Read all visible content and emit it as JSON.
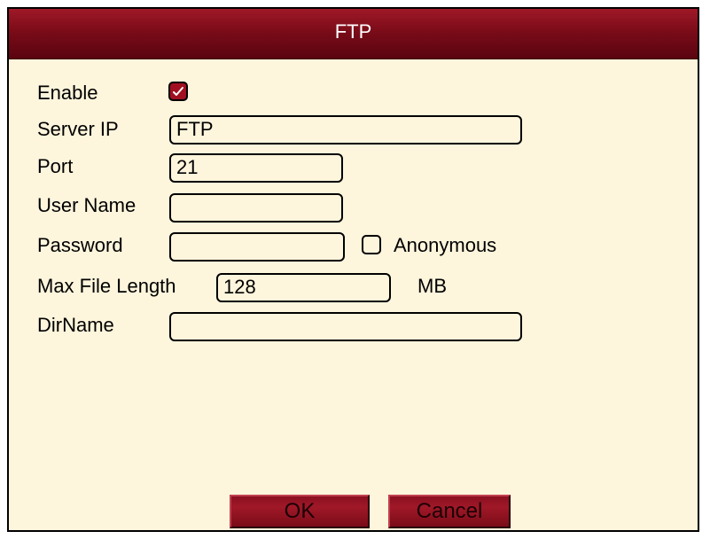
{
  "dialog": {
    "title": "FTP"
  },
  "form": {
    "enable": {
      "label": "Enable",
      "checked": true
    },
    "server_ip": {
      "label": "Server IP",
      "value": "FTP"
    },
    "port": {
      "label": "Port",
      "value": "21"
    },
    "user_name": {
      "label": "User Name",
      "value": ""
    },
    "password": {
      "label": "Password",
      "value": ""
    },
    "anonymous": {
      "label": "Anonymous",
      "checked": false
    },
    "max_file_length": {
      "label": "Max File Length",
      "value": "128",
      "unit": "MB"
    },
    "dir_name": {
      "label": "DirName",
      "value": ""
    }
  },
  "buttons": {
    "ok": "OK",
    "cancel": "Cancel"
  },
  "colors": {
    "title_bar": "#7a0c18",
    "background": "#fdf5dc",
    "checkbox_checked": "#a01020"
  },
  "icons": {
    "enable_checkbox": "checkmark-icon"
  }
}
